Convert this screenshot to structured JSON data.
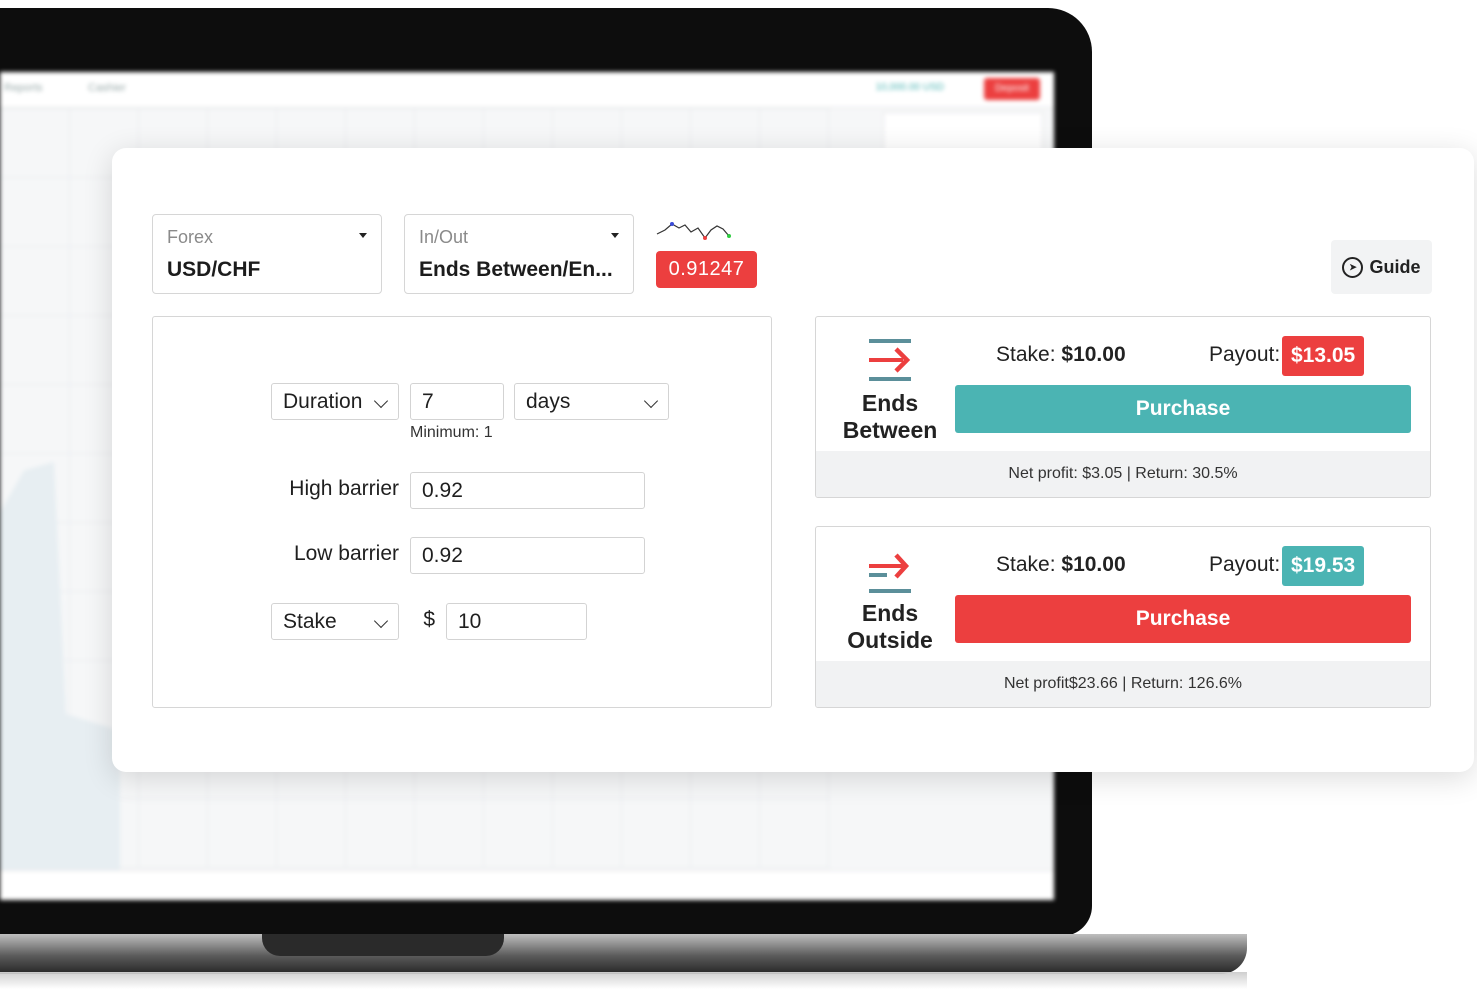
{
  "background": {
    "nav_reports": "Reports",
    "nav_cashier": "Cashier",
    "balance": "10,000.00 USD",
    "deposit": "Deposit"
  },
  "market": {
    "category": "Forex",
    "symbol": "USD/CHF",
    "trade_category": "In/Out",
    "trade_type": "Ends Between/En...",
    "price": "0.91247",
    "price_color": "#ec3f3f"
  },
  "guide": {
    "label": "Guide",
    "icon": "compass-icon"
  },
  "form": {
    "duration_select": "Duration",
    "duration_value": "7",
    "duration_unit": "days",
    "duration_hint": "Minimum: 1",
    "high_barrier_label": "High barrier",
    "high_barrier_value": "0.92",
    "low_barrier_label": "Low barrier",
    "low_barrier_value": "0.92",
    "stake_select": "Stake",
    "currency_symbol": "$",
    "stake_value": "10"
  },
  "contracts": [
    {
      "line1": "Ends",
      "line2": "Between",
      "stake_label": "Stake:",
      "stake_value": "$10.00",
      "payout_label": "Payout:",
      "payout_value": "$13.05",
      "payout_color": "#ec3f3f",
      "button_label": "Purchase",
      "button_color": "#4bb4b3",
      "footer": "Net profit: $3.05 | Return: 30.5%"
    },
    {
      "line1": "Ends",
      "line2": "Outside",
      "stake_label": "Stake:",
      "stake_value": "$10.00",
      "payout_label": "Payout:",
      "payout_value": "$19.53",
      "payout_color": "#4bb4b3",
      "button_label": "Purchase",
      "button_color": "#ec3f3f",
      "footer": "Net profit$23.66 | Return: 126.6%"
    }
  ]
}
